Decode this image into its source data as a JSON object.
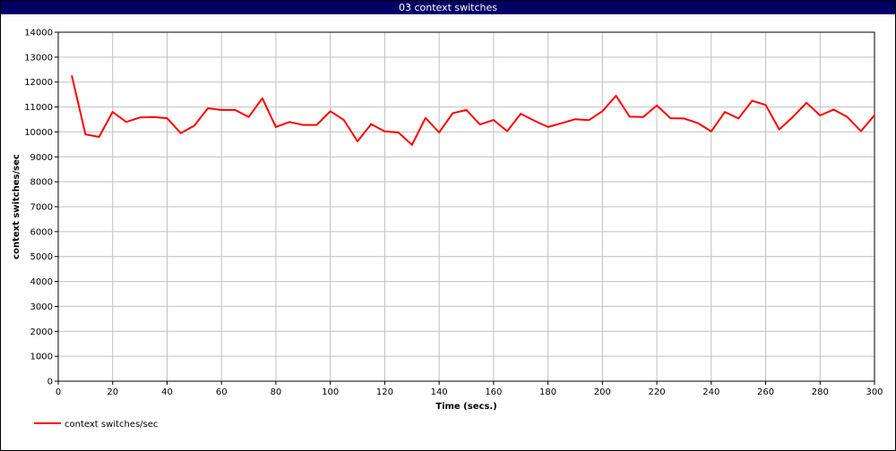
{
  "window": {
    "title": "03 context switches"
  },
  "colors": {
    "titlebar_bg": "#000066",
    "series": "#ff0000",
    "grid": "#c0c0c0"
  },
  "chart_data": {
    "type": "line",
    "title": "03 context switches",
    "xlabel": "Time (secs.)",
    "ylabel": "context switches/sec",
    "xlim": [
      0,
      300
    ],
    "ylim": [
      0,
      14000
    ],
    "x_ticks": [
      0,
      20,
      40,
      60,
      80,
      100,
      120,
      140,
      160,
      180,
      200,
      220,
      240,
      260,
      280,
      300
    ],
    "y_ticks": [
      0,
      1000,
      2000,
      3000,
      4000,
      5000,
      6000,
      7000,
      8000,
      9000,
      10000,
      11000,
      12000,
      13000,
      14000
    ],
    "grid": true,
    "legend_position": "bottom-left",
    "series": [
      {
        "name": "context switches/sec",
        "color": "#ff0000",
        "x": [
          5,
          10,
          15,
          20,
          25,
          30,
          35,
          40,
          45,
          50,
          55,
          60,
          65,
          70,
          75,
          80,
          85,
          90,
          95,
          100,
          105,
          110,
          115,
          120,
          125,
          130,
          135,
          140,
          145,
          150,
          155,
          160,
          165,
          170,
          175,
          180,
          185,
          190,
          195,
          200,
          205,
          210,
          215,
          220,
          225,
          230,
          235,
          240,
          245,
          250,
          255,
          260,
          265,
          270,
          275,
          280,
          285,
          290,
          295,
          300
        ],
        "values": [
          12250,
          9900,
          9800,
          10800,
          10400,
          10580,
          10600,
          10550,
          9950,
          10250,
          10950,
          10880,
          10880,
          10600,
          11350,
          10200,
          10400,
          10280,
          10280,
          10830,
          10480,
          9620,
          10310,
          10020,
          9980,
          9480,
          10560,
          9980,
          10750,
          10880,
          10300,
          10480,
          10030,
          10730,
          10450,
          10200,
          10350,
          10510,
          10470,
          10830,
          11450,
          10610,
          10600,
          11060,
          10550,
          10540,
          10360,
          10020,
          10800,
          10540,
          11250,
          11080,
          10100,
          10600,
          11170,
          10660,
          10900,
          10600,
          10030,
          10670
        ]
      }
    ]
  }
}
